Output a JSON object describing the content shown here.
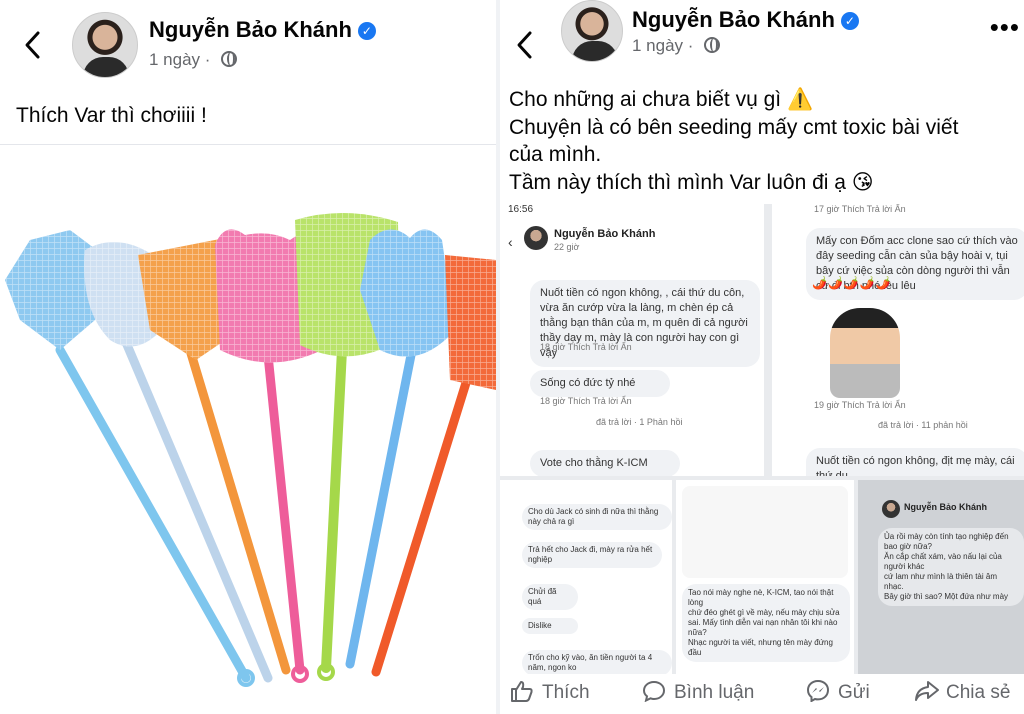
{
  "left_post": {
    "author": "Nguyễn Bảo Khánh",
    "time": "1 ngày",
    "caption": "Thích Var thì chơiiii !",
    "icons": {
      "back": "back-arrow-icon",
      "privacy": "globe-icon",
      "verified": "verified-badge-icon"
    }
  },
  "right_post": {
    "author": "Nguyễn Bảo Khánh",
    "time": "1 ngày",
    "lines": [
      "Cho những ai chưa biết vụ gì ⚠️",
      "Chuyện là có bên seeding mấy cmt toxic bài viết",
      "của mình.",
      "Tầm này thích thì mình Var luôn đi ạ 😘"
    ],
    "more": "•••",
    "collage": {
      "s1_author": "Nguyễn Bảo Khánh",
      "s1_time": "22 giờ",
      "s1_status": "16:56",
      "s1_comment1": "Nuốt tiền có ngon không, , cái thứ du côn, vừa ăn cướp vừa la làng, m chèn ép cả thằng bạn thân của m, m quên đi cả người thầy dạy m, mày là con người hay con gì vậy",
      "s1_meta1": "18 giờ   Thích   Trả lời   Ẩn",
      "s1_comment2": "Sống có đức tỷ nhé",
      "s1_meta2": "18 giờ   Thích   Trả lời   Ẩn",
      "s1_replied": "đã trả lời · 1 Phản hồi",
      "s1_comment3": "Vote         cho thằng K-ICM",
      "s2_meta_top": "17 giờ   Thích   Trả lời   Ẩn",
      "s2_comment1": "Mấy con Đốm acc clone sao cứ thích vào đây seeding cẫn càn sủa bậy hoài v, tụi bây cứ việc sủa còn dòng người thì vẫn cứ đi bth nhé lêu lêu",
      "s2_hearts": "🌶️🌶️🌶️🌶️🌶️",
      "s2_meta2": "19 giờ   Thích   Trả lời   Ẩn",
      "s2_replied": "đã trả lời · 11 phản hồi",
      "s2_comment2": "Nuốt tiền có ngon không, địt mẹ mày, cái thứ du",
      "s3_lines": [
        "Cho dù Jack có sinh đi nữa thì thằng này chả ra gì",
        "Trả hết cho Jack đi, mày ra rửa hết nghiệp",
        "Chửi đã quá",
        "Dislike",
        "Trốn cho kỹ vào, ăn tiền người ta 4 năm, ngon ko"
      ],
      "s4_lines": [
        "Tao nói mày nghe nè, K-ICM, tao nói thật lòng",
        "chứ đéo ghét gì về mày, nếu mày chịu sửa",
        "sai. Mấy tình diễn vai nạn nhân tôi khi nào nữa?",
        "Nhạc người ta viết, nhưng tên mày đứng đầu"
      ],
      "s5_author": "Nguyễn Bảo Khánh",
      "s5_lines": [
        "Ủa rồi mày còn tính tạo nghiệp đến bao giờ nữa?",
        "Ăn cắp chất xám, vào nấu lại của người khác",
        "cứ lam như mình là thiên tài âm nhạc.",
        "Bây giờ thì sao? Một đứa như mày"
      ]
    }
  },
  "actions": {
    "like": "Thích",
    "comment": "Bình luận",
    "send": "Gửi",
    "share": "Chia sẻ"
  },
  "colors": {
    "accent": "#1877f2",
    "muted": "#65676b",
    "text": "#050505"
  }
}
